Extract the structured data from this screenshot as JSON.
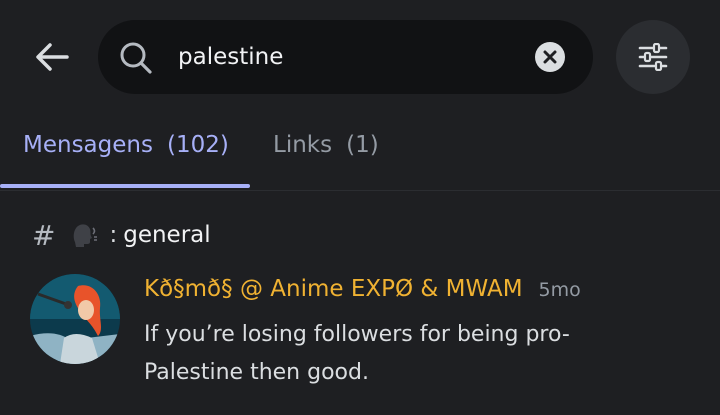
{
  "search": {
    "value": "palestine",
    "placeholder": "Search"
  },
  "tabs": [
    {
      "label": "Mensagens",
      "count": "(102)",
      "active": true
    },
    {
      "label": "Links",
      "count": "(1)",
      "active": false
    }
  ],
  "channel": {
    "prefix": "#",
    "separator": ":",
    "name": "general"
  },
  "message": {
    "author": "Kð§mð§ @ Anime EXPØ & MWAM",
    "timestamp": "5mo",
    "text": "If you’re losing followers for being pro-Palestine then good."
  },
  "colors": {
    "background": "#1e1f22",
    "search_bg": "#111214",
    "accent": "#a7b0f7",
    "author": "#f0b232"
  },
  "icons": {
    "back": "arrow-left-icon",
    "search": "search-icon",
    "clear": "close-circle-icon",
    "filter": "sliders-icon",
    "channel": "speaking-head-icon"
  }
}
